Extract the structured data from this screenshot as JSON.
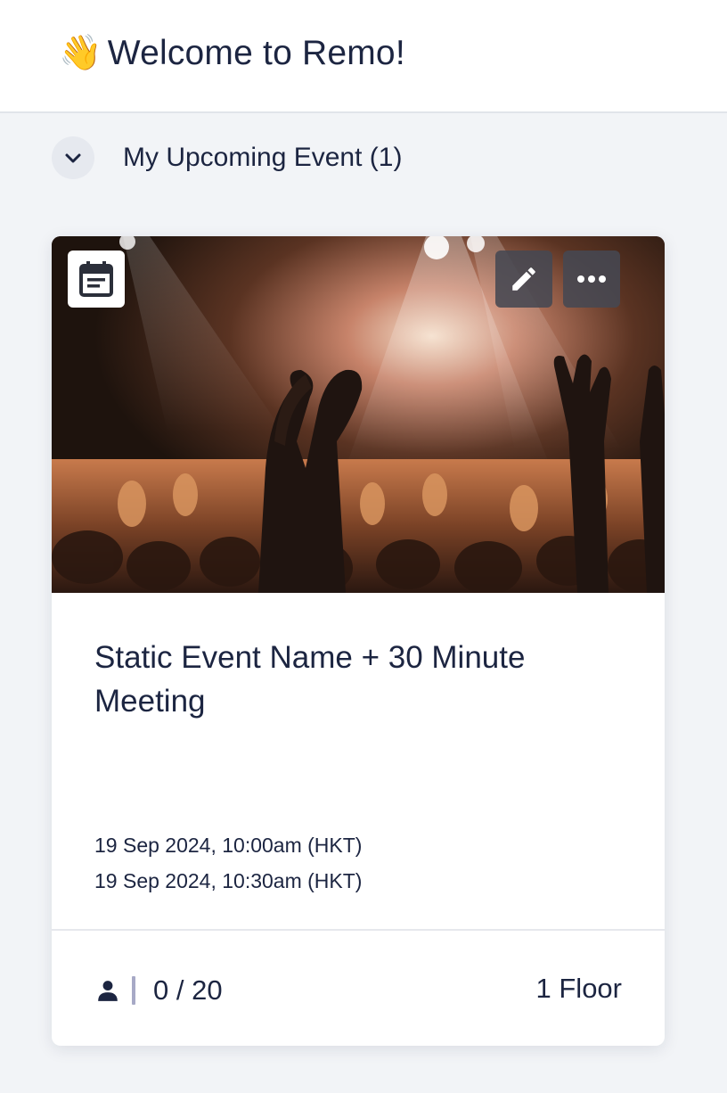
{
  "header": {
    "wave_emoji": "👋",
    "welcome_text": "Welcome to Remo!"
  },
  "section": {
    "title": "My Upcoming Event (1)",
    "expanded": true
  },
  "event_card": {
    "title": "Static Event Name + 30 Minute Meeting",
    "start_time": "19 Sep 2024, 10:00am (HKT)",
    "end_time": "19 Sep 2024, 10:30am (HKT)",
    "attendance": "0 / 20",
    "floors": "1 Floor",
    "cover_image": "concert crowd with hands forming a heart",
    "icons": {
      "badge": "calendar-icon",
      "edit": "pencil-icon",
      "more": "more-horizontal-icon",
      "attendees": "person-icon"
    }
  },
  "colors": {
    "text": "#1c2541",
    "page_background": "#f2f4f7",
    "card_background": "#ffffff",
    "divider_accent": "#a7a9c6"
  }
}
